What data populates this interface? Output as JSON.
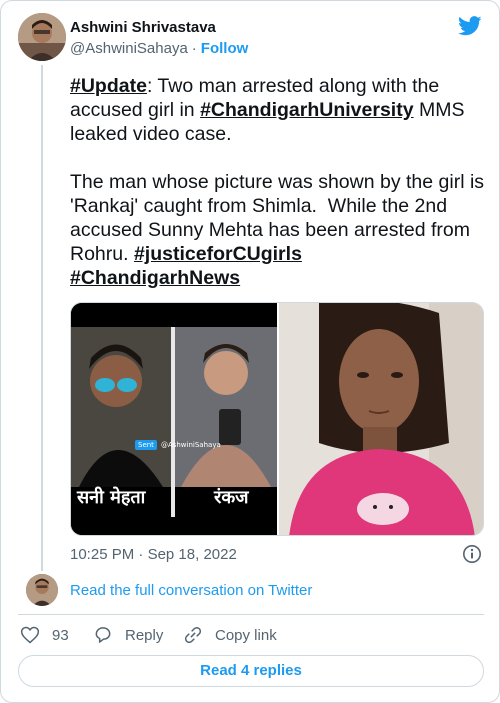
{
  "author": {
    "name": "Ashwini Shrivastava",
    "handle": "@AshwiniSahaya",
    "separator": "·",
    "follow_label": "Follow"
  },
  "tweet": {
    "hashtag_update": "#Update",
    "text_1": ": Two man arrested along with the accused girl in ",
    "hashtag_university": "#ChandigarhUniversity",
    "text_2": " MMS leaked video case.\n\nThe man whose picture was shown by the girl is 'Rankaj' caught from Shimla.  While the 2nd accused Sunny Mehta has been arrested from Rohru. ",
    "hashtag_justice": "#justiceforCUgirls",
    "hashtag_news": "#ChandigarhNews"
  },
  "media": {
    "left_caption_1": "सनी मेहता",
    "left_caption_2": "रंकज",
    "watermark_badge": "Sent",
    "watermark_text": "@AshwiniSahaya"
  },
  "timestamp": {
    "time": "10:25 PM",
    "separator": "·",
    "date": "Sep 18, 2022"
  },
  "conversation": {
    "read_label": "Read the full conversation on Twitter"
  },
  "actions": {
    "like_count": "93",
    "reply_label": "Reply",
    "copy_label": "Copy link"
  },
  "replies": {
    "label": "Read 4 replies"
  },
  "colors": {
    "accent": "#1d9bf0",
    "text": "#0f1419",
    "muted": "#536471",
    "border": "#cfd9de"
  },
  "icons": {
    "brand": "twitter-bird-icon",
    "info": "info-icon",
    "like": "heart-icon",
    "reply": "speech-bubble-icon",
    "copy": "link-icon"
  }
}
